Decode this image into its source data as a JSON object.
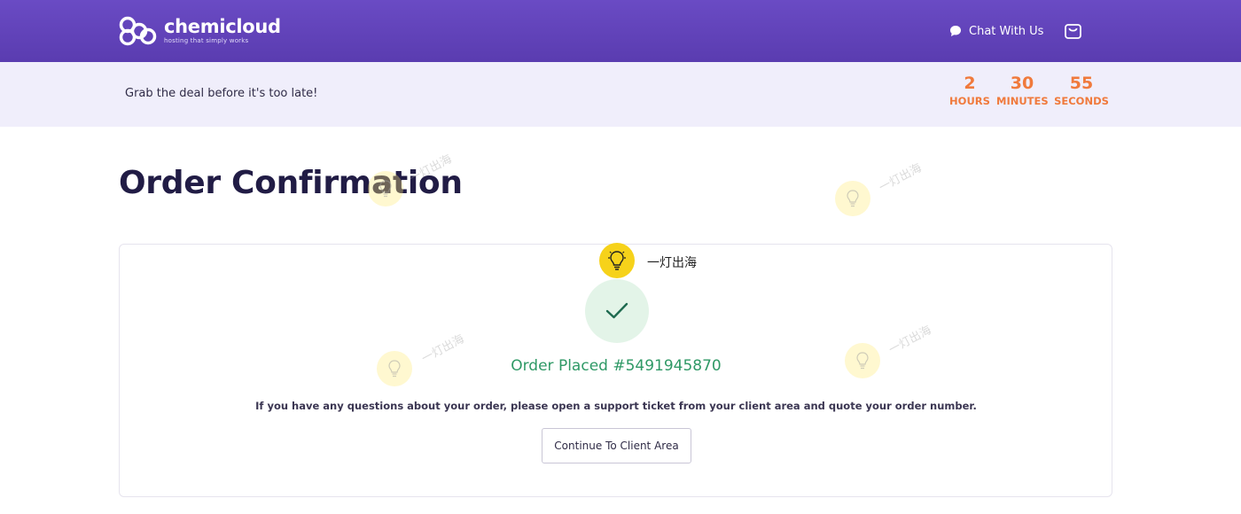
{
  "header": {
    "logo_name": "chemicloud",
    "logo_tagline": "hosting that simply works",
    "chat_label": "Chat With Us",
    "chat_icon": "chat-bubble-icon",
    "cart_icon": "shopping-bag-icon",
    "accent_color": "#5f42b8"
  },
  "promo": {
    "message": "Grab the deal before it's too late!",
    "countdown": {
      "hours": "2",
      "hours_label": "HOURS",
      "minutes": "30",
      "minutes_label": "MINUTES",
      "seconds": "55",
      "seconds_label": "SECONDS",
      "color": "#f07a3c"
    }
  },
  "page": {
    "title": "Order Confirmation"
  },
  "confirmation": {
    "status_icon": "checkmark-icon",
    "order_placed": "Order Placed #5491945870",
    "help_text": "If you have any questions about your order, please open a support ticket from your client area and quote your order number.",
    "continue_label": "Continue To Client Area",
    "success_color": "#2f9966"
  },
  "watermark": {
    "text": "一灯出海",
    "icon": "lightbulb-icon"
  }
}
